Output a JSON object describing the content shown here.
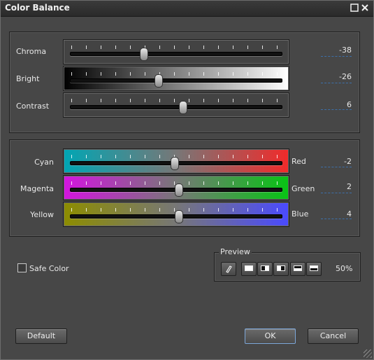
{
  "window": {
    "title": "Color Balance"
  },
  "tone_group": {
    "sliders": [
      {
        "label": "Chroma",
        "value": "-38",
        "fraction": 0.34
      },
      {
        "label": "Bright",
        "value": "-26",
        "fraction": 0.41
      },
      {
        "label": "Contrast",
        "value": "6",
        "fraction": 0.53
      }
    ]
  },
  "color_group": {
    "sliders": [
      {
        "left": "Cyan",
        "right": "Red",
        "value": "-2",
        "fraction": 0.49,
        "from": "#00a6b4",
        "to": "#f22a2a"
      },
      {
        "left": "Magenta",
        "right": "Green",
        "value": "2",
        "fraction": 0.51,
        "from": "#d414e0",
        "to": "#07c414"
      },
      {
        "left": "Yellow",
        "right": "Blue",
        "value": "4",
        "fraction": 0.51,
        "from": "#8d8d00",
        "to": "#4a4aff"
      }
    ]
  },
  "safe_color": {
    "label": "Safe Color",
    "checked": false
  },
  "preview": {
    "label": "Preview",
    "zoom": "50%",
    "buttons": [
      "eraser-icon",
      "full-preview-icon",
      "left-split-icon",
      "right-split-icon",
      "top-split-icon",
      "bottom-split-icon"
    ]
  },
  "buttons": {
    "default": "Default",
    "ok": "OK",
    "cancel": "Cancel"
  },
  "colors": {
    "accent": "#7da7d9",
    "panel": "#474747",
    "titlebar": "#2a2a2a"
  }
}
